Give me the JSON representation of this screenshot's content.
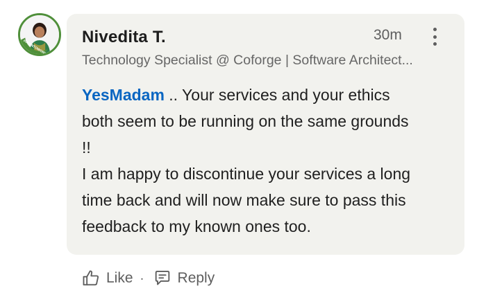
{
  "comment": {
    "author": "Nivedita T.",
    "time": "30m",
    "headline": "Technology Specialist @ Coforge | Software Architect...",
    "mention": "YesMadam",
    "lines": [
      " .. Your services and your ethics",
      "both seem to be running on the same grounds",
      "!!",
      "I am happy to discontinue your services a long",
      "time back and will now make sure to pass this",
      "feedback to my known ones too."
    ]
  },
  "avatar": {
    "badge_text": "#OPENTOWORK",
    "badge_color": "#4f8f3a"
  },
  "actions": {
    "like_label": "Like",
    "separator": "·",
    "reply_label": "Reply"
  },
  "icons": {
    "more": "more-vertical-icon",
    "like": "thumbs-up-icon",
    "reply": "speech-bubble-icon"
  },
  "colors": {
    "mention": "#0a66c2",
    "bubble": "#f2f2ee",
    "muted": "#5e5e5e"
  }
}
